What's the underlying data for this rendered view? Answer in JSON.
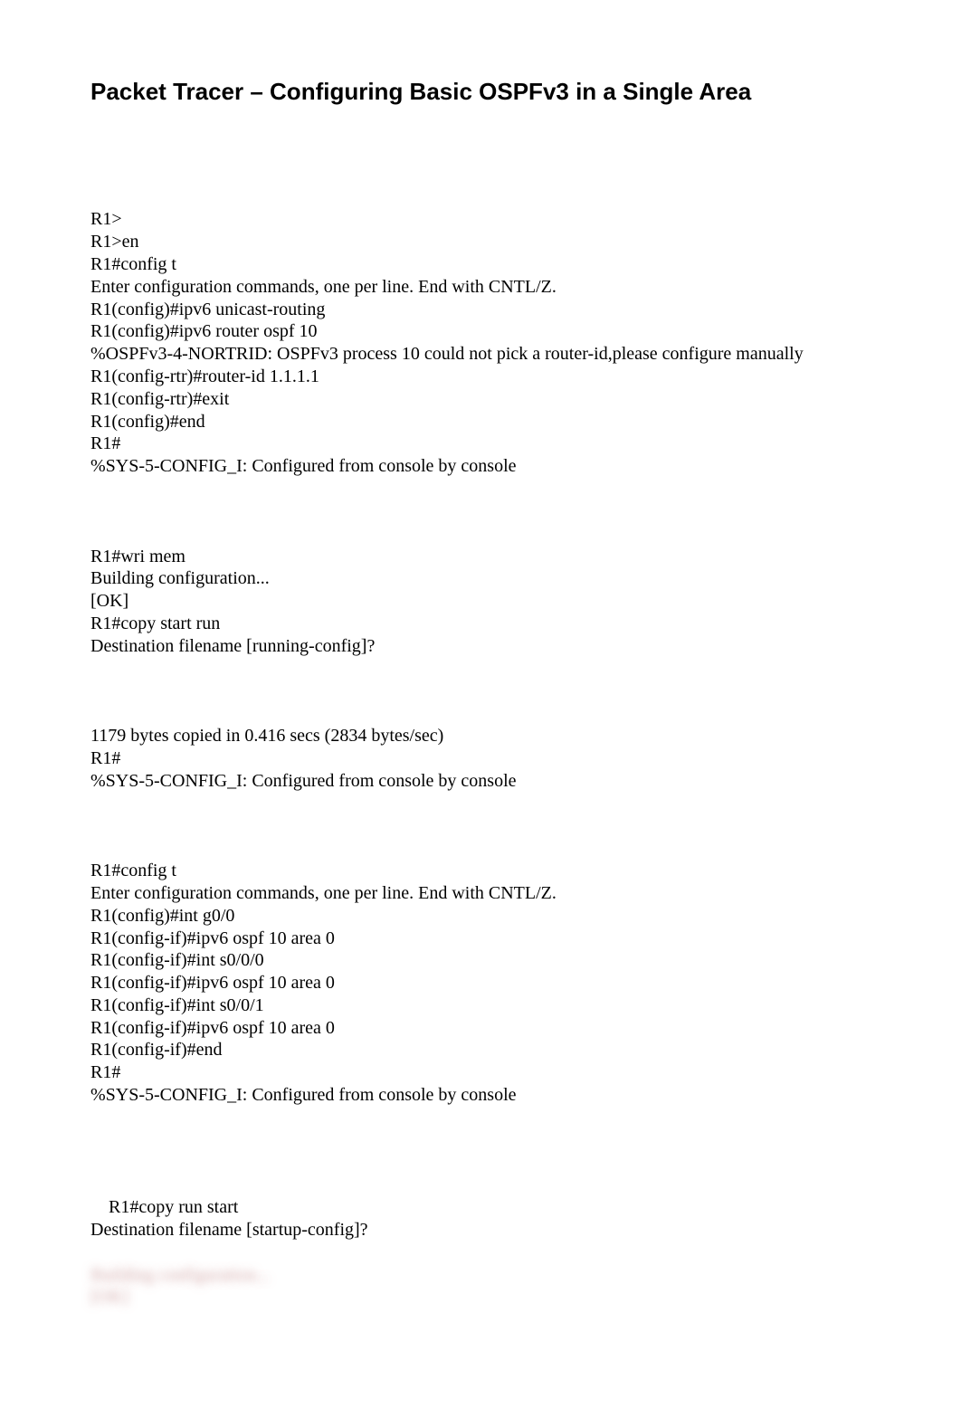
{
  "title": "Packet Tracer – Configuring Basic OSPFv3 in a Single Area",
  "blocks": {
    "b1": "R1>\nR1>en\nR1#config t\nEnter configuration commands, one per line. End with CNTL/Z.\nR1(config)#ipv6 unicast-routing\nR1(config)#ipv6 router ospf 10\n%OSPFv3-4-NORTRID: OSPFv3 process 10 could not pick a router-id,please configure manually\nR1(config-rtr)#router-id 1.1.1.1\nR1(config-rtr)#exit\nR1(config)#end\nR1#\n%SYS-5-CONFIG_I: Configured from console by console",
    "b2": "R1#wri mem\nBuilding configuration...\n[OK]\nR1#copy start run\nDestination filename [running-config]?",
    "b3": "1179 bytes copied in 0.416 secs (2834 bytes/sec)\nR1#\n%SYS-5-CONFIG_I: Configured from console by console",
    "b4": "R1#config t\nEnter configuration commands, one per line. End with CNTL/Z.\nR1(config)#int g0/0\nR1(config-if)#ipv6 ospf 10 area 0\nR1(config-if)#int s0/0/0\nR1(config-if)#ipv6 ospf 10 area 0\nR1(config-if)#int s0/0/1\nR1(config-if)#ipv6 ospf 10 area 0\nR1(config-if)#end\nR1#\n%SYS-5-CONFIG_I: Configured from console by console",
    "b5": "R1#copy run start\nDestination filename [startup-config]?",
    "blurred": "Building configuration...\n[OK]"
  }
}
